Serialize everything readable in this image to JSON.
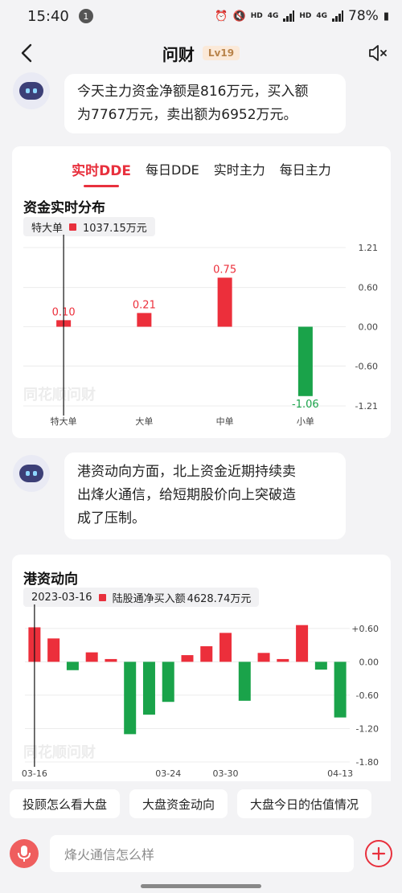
{
  "status": {
    "time": "15:40",
    "notif": "1",
    "hd1": "HD",
    "net1": "4G",
    "hd2": "HD",
    "net2": "4G",
    "battery": "78%"
  },
  "header": {
    "title": "问财",
    "level": "Lv19"
  },
  "messages": {
    "msg1_lines": [
      "今天主力资金净额是816万元，买入额",
      "为7767万元，卖出额为6952万元。"
    ],
    "msg2_lines": [
      "港资动向方面，北上资金近期持续卖",
      "出烽火通信，给短期股价向上突破造",
      "成了压制。"
    ]
  },
  "dde_card": {
    "tabs": [
      "实时DDE",
      "每日DDE",
      "实时主力",
      "每日主力"
    ],
    "active_tab": 0,
    "title": "资金实时分布",
    "tooltip": {
      "label": "特大单",
      "value": "1037.15万元"
    },
    "watermark": "同花顺问财"
  },
  "hk_card": {
    "title": "港资动向",
    "tooltip": {
      "date": "2023-03-16",
      "label": "陆股通净买入额",
      "value": "4628.74万元"
    },
    "watermark": "同花顺问财"
  },
  "chart_data": [
    {
      "type": "bar",
      "title": "资金实时分布",
      "categories": [
        "特大单",
        "大单",
        "中单",
        "小单"
      ],
      "values": [
        0.1,
        0.21,
        0.75,
        -1.06
      ],
      "value_labels": [
        "0.10",
        "0.21",
        "0.75",
        "-1.06"
      ],
      "y_ticks": [
        "1.21",
        "0.60",
        "0.00",
        "-0.60",
        "-1.21"
      ],
      "ylim": [
        -1.21,
        1.21
      ],
      "colors": {
        "positive": "#ec2f3b",
        "negative": "#1aa34a"
      }
    },
    {
      "type": "bar",
      "title": "港资动向",
      "x_ticks": [
        "03-16",
        "03-24",
        "03-30",
        "04-13"
      ],
      "values": [
        0.62,
        0.42,
        -0.15,
        0.17,
        0.05,
        -1.3,
        -0.95,
        -0.72,
        0.12,
        0.28,
        0.52,
        -0.7,
        0.16,
        0.05,
        0.66,
        -0.14,
        -1.0
      ],
      "y_ticks": [
        "+0.60",
        "0.00",
        "-0.60",
        "-1.20",
        "-1.80"
      ],
      "ylim": [
        -1.8,
        0.8
      ],
      "colors": {
        "positive": "#ec2f3b",
        "negative": "#1aa34a"
      }
    }
  ],
  "quick_questions": [
    "投顾怎么看大盘",
    "大盘资金动向",
    "大盘今日的估值情况"
  ],
  "input": {
    "placeholder": "烽火通信怎么样"
  }
}
